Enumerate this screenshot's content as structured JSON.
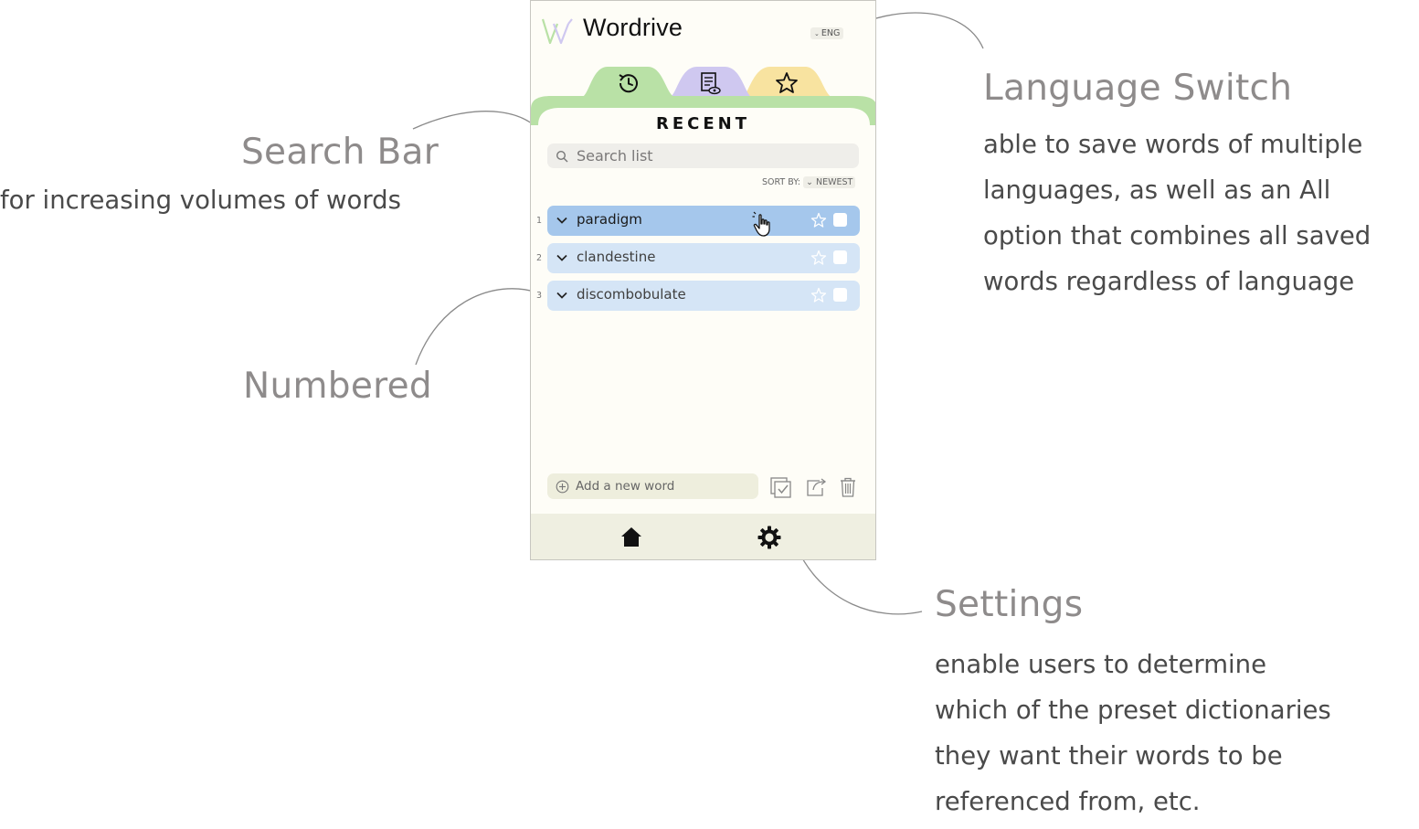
{
  "app": {
    "title": "Wordrive",
    "language": "ENG",
    "section_title": "RECENT",
    "search_placeholder": "Search list",
    "sort_label": "SORT BY:",
    "sort_value": "NEWEST",
    "tabs": [
      {
        "name": "recent",
        "icon": "history-icon",
        "color": "#b9e1a6"
      },
      {
        "name": "reviewed",
        "icon": "document-eye-icon",
        "color": "#cfc8f0"
      },
      {
        "name": "favorites",
        "icon": "star-icon",
        "color": "#f8e3a0"
      }
    ],
    "words": [
      {
        "number": "1",
        "word": "paradigm",
        "active": true
      },
      {
        "number": "2",
        "word": "clandestine",
        "active": false
      },
      {
        "number": "3",
        "word": "discombobulate",
        "active": false
      }
    ],
    "add_placeholder": "Add a new word",
    "colors": {
      "accent_green": "#b9e1a6",
      "row_active": "#a5c7ec",
      "row_default": "#d5e5f6",
      "bottom_bar": "#efefe1"
    }
  },
  "annotations": {
    "search_bar": {
      "title": "Search Bar",
      "body": [
        "for increasing volumes of words"
      ]
    },
    "numbered": {
      "title": "Numbered"
    },
    "language_switch": {
      "title": "Language Switch",
      "body": [
        "able to save words of multiple",
        "languages, as well as an All",
        "option that combines all saved",
        "words regardless of language"
      ]
    },
    "settings": {
      "title": "Settings",
      "body": [
        "enable users to determine",
        "which of the preset dictionaries",
        "they want their words to be",
        "referenced from, etc."
      ]
    }
  }
}
